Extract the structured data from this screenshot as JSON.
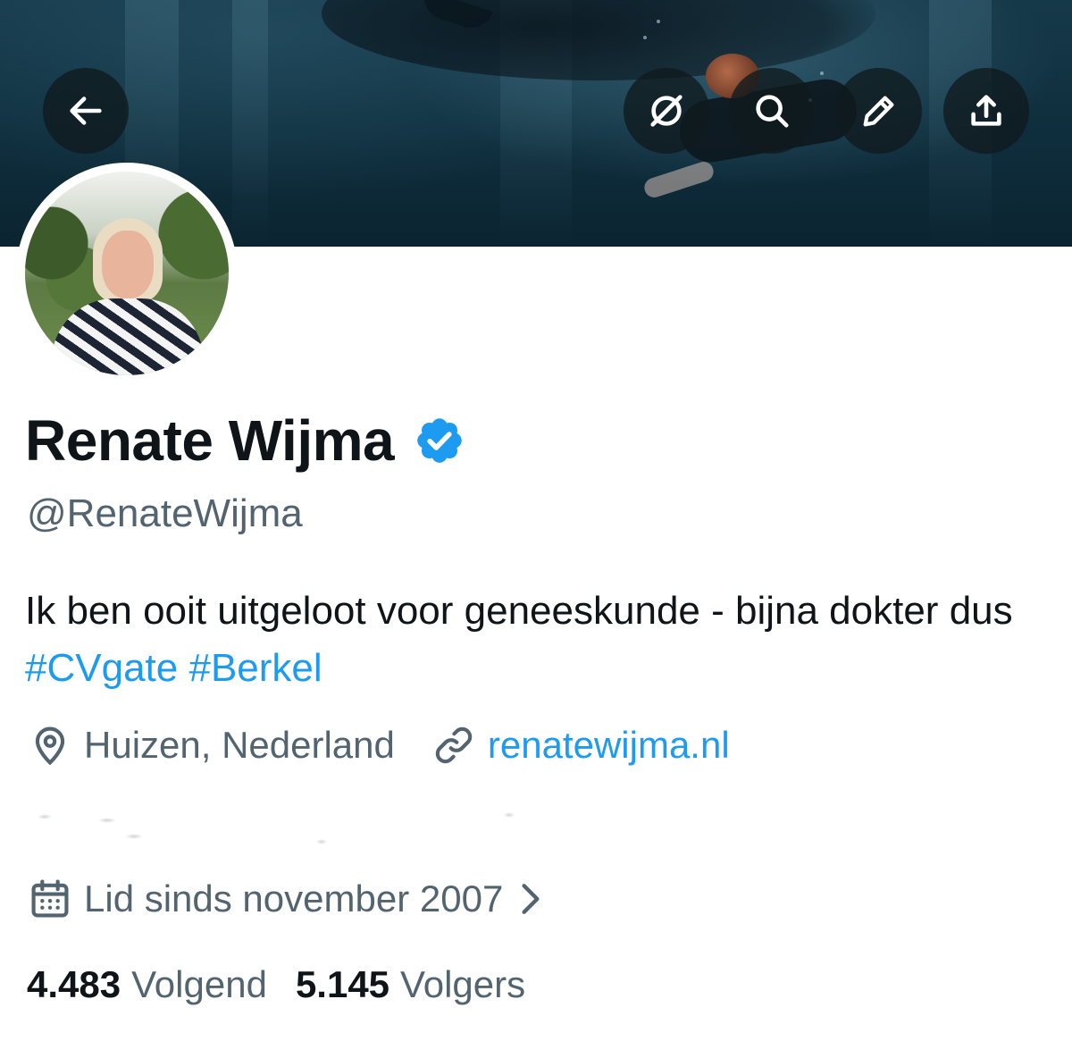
{
  "header": {
    "back_icon": "arrow-left-icon",
    "actions": [
      {
        "name": "hide-icon",
        "label": "Verbergen"
      },
      {
        "name": "search-icon",
        "label": "Zoeken"
      },
      {
        "name": "pencil-icon",
        "label": "Bewerken"
      },
      {
        "name": "share-icon",
        "label": "Delen"
      }
    ]
  },
  "profile": {
    "display_name": "Renate Wijma",
    "verified": true,
    "verified_color": "#1d9bf0",
    "handle": "@RenateWijma",
    "bio": {
      "text": "Ik ben ooit uitgeloot voor geneeskunde - bijna dokter dus",
      "hashtags": [
        "#CVgate",
        "#Berkel"
      ]
    },
    "location": "Huizen, Nederland",
    "website": "renatewijma.nl",
    "joined": "Lid sinds november 2007",
    "following_count": "4.483",
    "following_label": "Volgend",
    "followers_count": "5.145",
    "followers_label": "Volgers"
  },
  "colors": {
    "accent": "#1d9bf0",
    "text_primary": "#0f1419",
    "text_secondary": "#536471"
  }
}
